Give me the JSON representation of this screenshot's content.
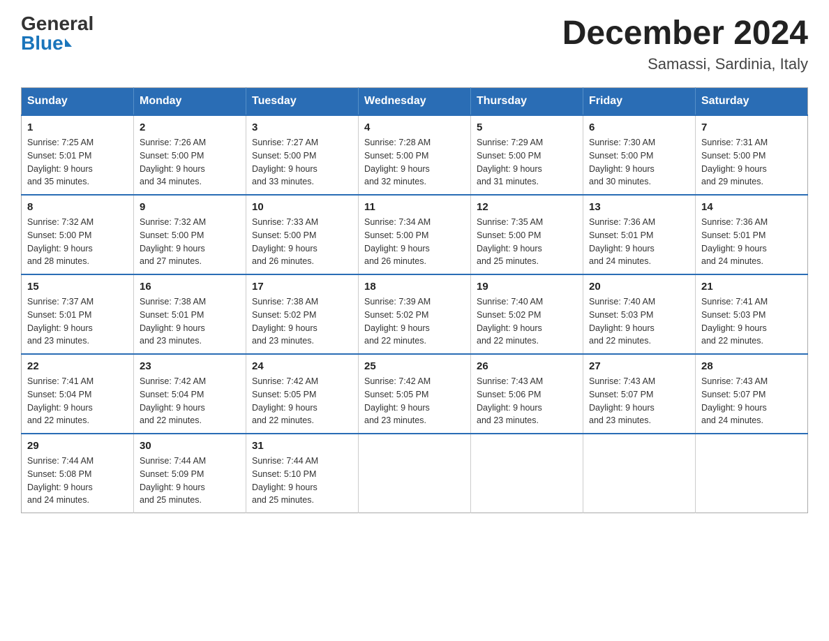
{
  "header": {
    "logo_general": "General",
    "logo_blue": "Blue",
    "month_title": "December 2024",
    "location": "Samassi, Sardinia, Italy"
  },
  "days_of_week": [
    "Sunday",
    "Monday",
    "Tuesday",
    "Wednesday",
    "Thursday",
    "Friday",
    "Saturday"
  ],
  "weeks": [
    [
      {
        "day": "1",
        "sunrise": "7:25 AM",
        "sunset": "5:01 PM",
        "daylight": "9 hours and 35 minutes."
      },
      {
        "day": "2",
        "sunrise": "7:26 AM",
        "sunset": "5:00 PM",
        "daylight": "9 hours and 34 minutes."
      },
      {
        "day": "3",
        "sunrise": "7:27 AM",
        "sunset": "5:00 PM",
        "daylight": "9 hours and 33 minutes."
      },
      {
        "day": "4",
        "sunrise": "7:28 AM",
        "sunset": "5:00 PM",
        "daylight": "9 hours and 32 minutes."
      },
      {
        "day": "5",
        "sunrise": "7:29 AM",
        "sunset": "5:00 PM",
        "daylight": "9 hours and 31 minutes."
      },
      {
        "day": "6",
        "sunrise": "7:30 AM",
        "sunset": "5:00 PM",
        "daylight": "9 hours and 30 minutes."
      },
      {
        "day": "7",
        "sunrise": "7:31 AM",
        "sunset": "5:00 PM",
        "daylight": "9 hours and 29 minutes."
      }
    ],
    [
      {
        "day": "8",
        "sunrise": "7:32 AM",
        "sunset": "5:00 PM",
        "daylight": "9 hours and 28 minutes."
      },
      {
        "day": "9",
        "sunrise": "7:32 AM",
        "sunset": "5:00 PM",
        "daylight": "9 hours and 27 minutes."
      },
      {
        "day": "10",
        "sunrise": "7:33 AM",
        "sunset": "5:00 PM",
        "daylight": "9 hours and 26 minutes."
      },
      {
        "day": "11",
        "sunrise": "7:34 AM",
        "sunset": "5:00 PM",
        "daylight": "9 hours and 26 minutes."
      },
      {
        "day": "12",
        "sunrise": "7:35 AM",
        "sunset": "5:00 PM",
        "daylight": "9 hours and 25 minutes."
      },
      {
        "day": "13",
        "sunrise": "7:36 AM",
        "sunset": "5:01 PM",
        "daylight": "9 hours and 24 minutes."
      },
      {
        "day": "14",
        "sunrise": "7:36 AM",
        "sunset": "5:01 PM",
        "daylight": "9 hours and 24 minutes."
      }
    ],
    [
      {
        "day": "15",
        "sunrise": "7:37 AM",
        "sunset": "5:01 PM",
        "daylight": "9 hours and 23 minutes."
      },
      {
        "day": "16",
        "sunrise": "7:38 AM",
        "sunset": "5:01 PM",
        "daylight": "9 hours and 23 minutes."
      },
      {
        "day": "17",
        "sunrise": "7:38 AM",
        "sunset": "5:02 PM",
        "daylight": "9 hours and 23 minutes."
      },
      {
        "day": "18",
        "sunrise": "7:39 AM",
        "sunset": "5:02 PM",
        "daylight": "9 hours and 22 minutes."
      },
      {
        "day": "19",
        "sunrise": "7:40 AM",
        "sunset": "5:02 PM",
        "daylight": "9 hours and 22 minutes."
      },
      {
        "day": "20",
        "sunrise": "7:40 AM",
        "sunset": "5:03 PM",
        "daylight": "9 hours and 22 minutes."
      },
      {
        "day": "21",
        "sunrise": "7:41 AM",
        "sunset": "5:03 PM",
        "daylight": "9 hours and 22 minutes."
      }
    ],
    [
      {
        "day": "22",
        "sunrise": "7:41 AM",
        "sunset": "5:04 PM",
        "daylight": "9 hours and 22 minutes."
      },
      {
        "day": "23",
        "sunrise": "7:42 AM",
        "sunset": "5:04 PM",
        "daylight": "9 hours and 22 minutes."
      },
      {
        "day": "24",
        "sunrise": "7:42 AM",
        "sunset": "5:05 PM",
        "daylight": "9 hours and 22 minutes."
      },
      {
        "day": "25",
        "sunrise": "7:42 AM",
        "sunset": "5:05 PM",
        "daylight": "9 hours and 23 minutes."
      },
      {
        "day": "26",
        "sunrise": "7:43 AM",
        "sunset": "5:06 PM",
        "daylight": "9 hours and 23 minutes."
      },
      {
        "day": "27",
        "sunrise": "7:43 AM",
        "sunset": "5:07 PM",
        "daylight": "9 hours and 23 minutes."
      },
      {
        "day": "28",
        "sunrise": "7:43 AM",
        "sunset": "5:07 PM",
        "daylight": "9 hours and 24 minutes."
      }
    ],
    [
      {
        "day": "29",
        "sunrise": "7:44 AM",
        "sunset": "5:08 PM",
        "daylight": "9 hours and 24 minutes."
      },
      {
        "day": "30",
        "sunrise": "7:44 AM",
        "sunset": "5:09 PM",
        "daylight": "9 hours and 25 minutes."
      },
      {
        "day": "31",
        "sunrise": "7:44 AM",
        "sunset": "5:10 PM",
        "daylight": "9 hours and 25 minutes."
      },
      null,
      null,
      null,
      null
    ]
  ],
  "labels": {
    "sunrise": "Sunrise:",
    "sunset": "Sunset:",
    "daylight": "Daylight:"
  }
}
